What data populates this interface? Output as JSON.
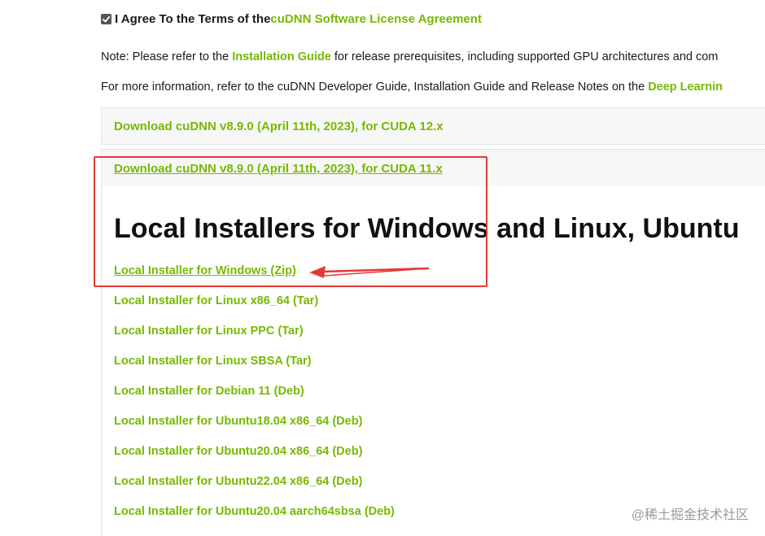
{
  "agreement": {
    "prefix": "I Agree To the Terms of the ",
    "link": "cuDNN Software License Agreement",
    "checked": true
  },
  "note_line": {
    "prefix": "Note: Please refer to the ",
    "link": "Installation Guide",
    "suffix": " for release prerequisites, including supported GPU architectures and com"
  },
  "info_line": {
    "prefix": "For more information, refer to the cuDNN Developer Guide, Installation Guide and Release Notes on the ",
    "link": "Deep Learnin"
  },
  "downloads": [
    {
      "label": "Download cuDNN v8.9.0 (April 11th, 2023), for CUDA 12.x"
    },
    {
      "label": "Download cuDNN v8.9.0 (April 11th, 2023), for CUDA 11.x"
    }
  ],
  "section_title": "Local Installers for Windows and Linux, Ubuntu",
  "installers": [
    {
      "label": "Local Installer for Windows (Zip)"
    },
    {
      "label": "Local Installer for Linux x86_64 (Tar)"
    },
    {
      "label": "Local Installer for Linux PPC (Tar)"
    },
    {
      "label": "Local Installer for Linux SBSA (Tar)"
    },
    {
      "label": "Local Installer for Debian 11 (Deb)"
    },
    {
      "label": "Local Installer for Ubuntu18.04 x86_64 (Deb)"
    },
    {
      "label": "Local Installer for Ubuntu20.04 x86_64 (Deb)"
    },
    {
      "label": "Local Installer for Ubuntu22.04 x86_64 (Deb)"
    },
    {
      "label": "Local Installer for Ubuntu20.04 aarch64sbsa (Deb)"
    }
  ],
  "watermark": "@稀土掘金技术社区",
  "colors": {
    "nvidia_green": "#76b900",
    "annotation_red": "#e53935",
    "panel_bg": "#f7f7f7"
  }
}
